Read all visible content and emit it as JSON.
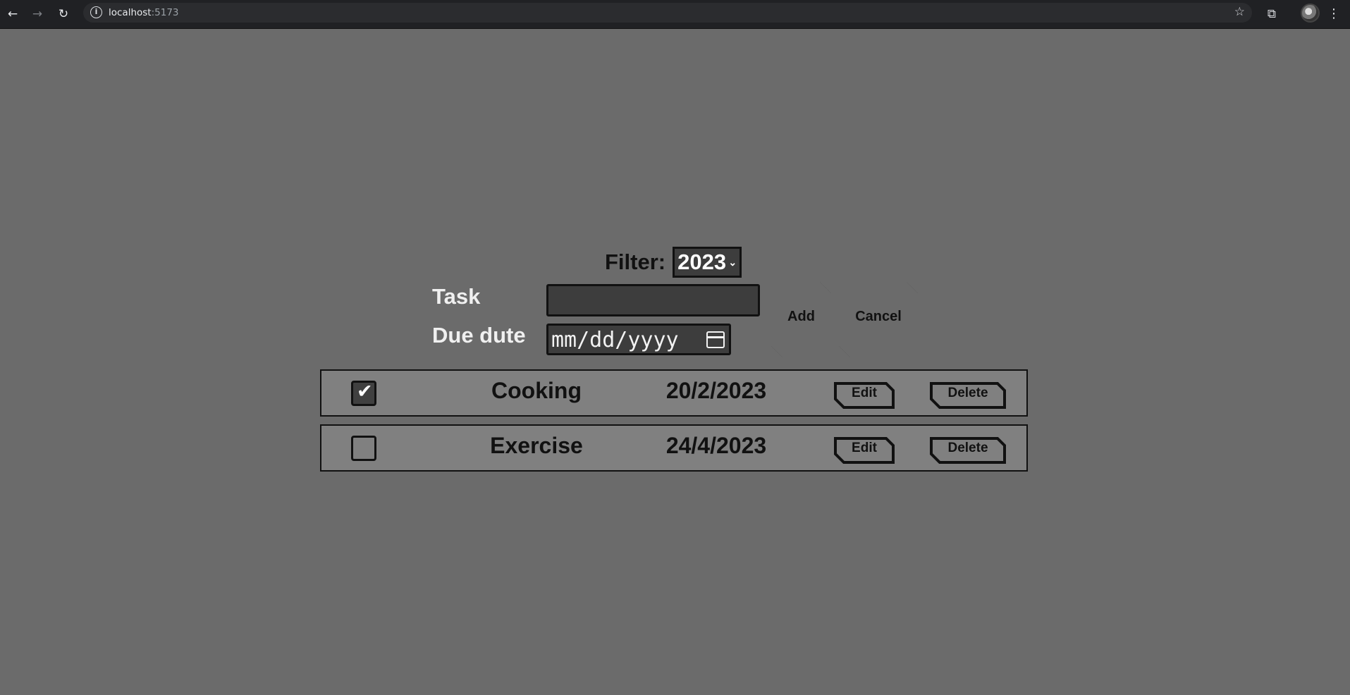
{
  "browser": {
    "url_host": "localhost",
    "url_port": ":5173",
    "icons": [
      "back-arrow-icon",
      "forward-arrow-icon",
      "reload-icon",
      "site-info-icon",
      "bookmark-star-icon",
      "extensions-icon",
      "profile-avatar",
      "menu-dots-icon"
    ]
  },
  "filter": {
    "label": "Filter:",
    "selected": "2023"
  },
  "form": {
    "task_label": "Task",
    "task_value": "",
    "due_label": "Due dute",
    "date_placeholder": "mm/dd/yyyy",
    "add_label": "Add",
    "cancel_label": "Cancel"
  },
  "tasks": [
    {
      "name": "Cooking",
      "date": "20/2/2023",
      "done": true,
      "edit_label": "Edit",
      "delete_label": "Delete"
    },
    {
      "name": "Exercise",
      "date": "24/4/2023",
      "done": false,
      "edit_label": "Edit",
      "delete_label": "Delete"
    }
  ],
  "colors": {
    "page_bg": "#6b6b6b",
    "row_bg": "#808080",
    "input_bg": "#3d3d3d",
    "chrome_bg": "#202124"
  }
}
